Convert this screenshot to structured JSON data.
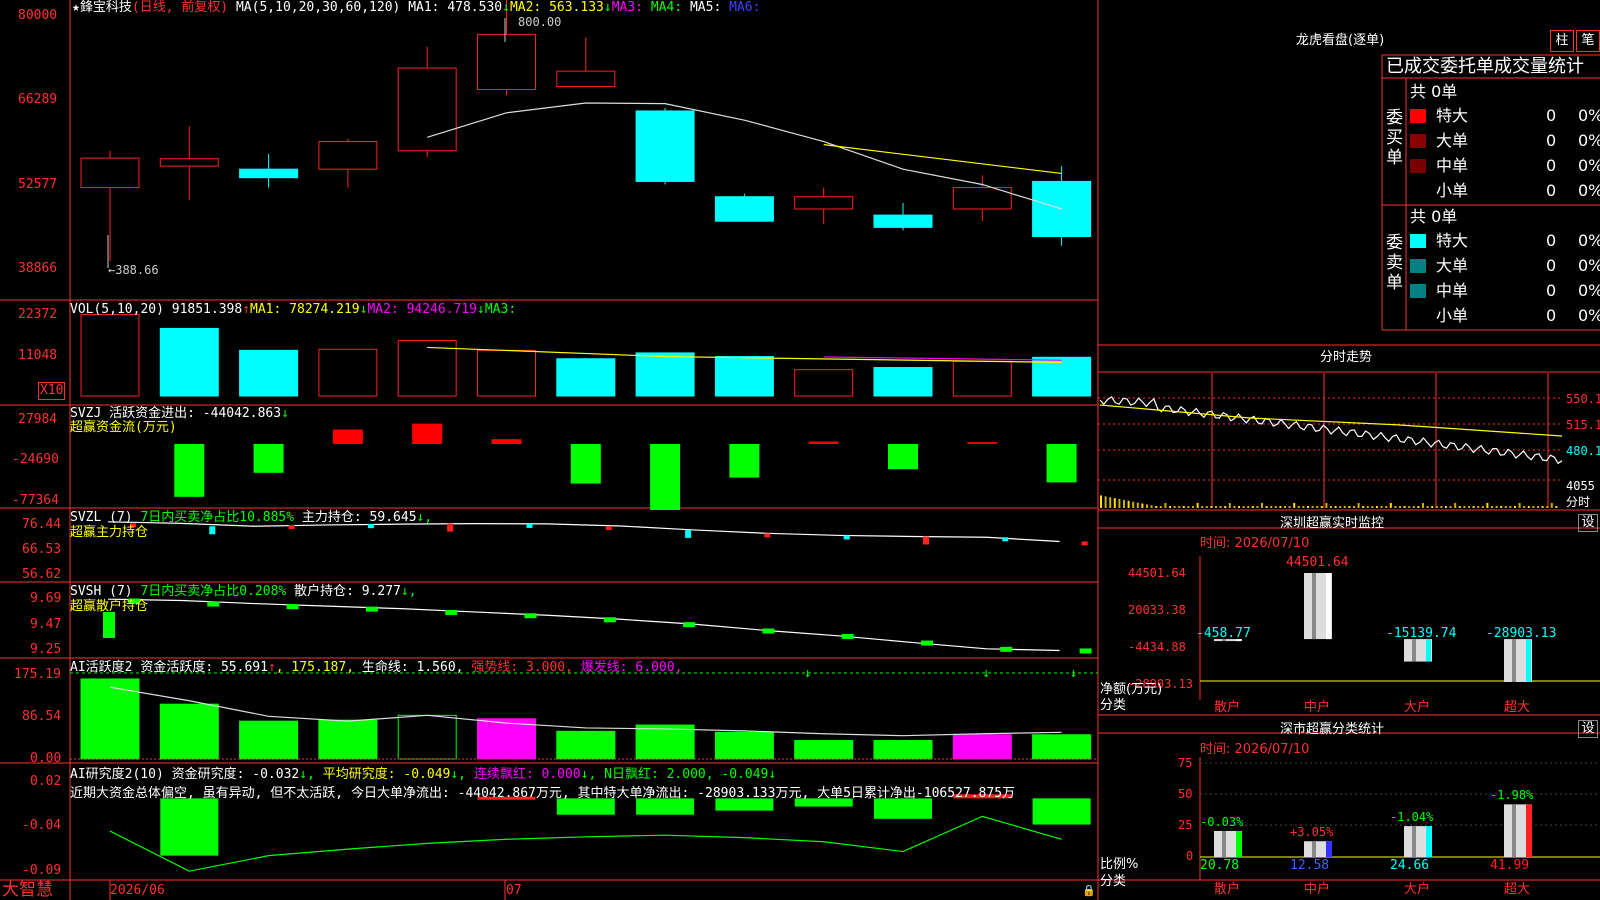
{
  "colors": {
    "up": "#ff2020",
    "down": "#00ffff",
    "green": "#00ff00",
    "magenta": "#ff00ff",
    "yellow": "#ffff00",
    "white": "#ffffff",
    "grid": "#c00000",
    "axis": "#ff3030",
    "darkred": "#8b0000",
    "teal": "#008080"
  },
  "price_panel": {
    "title_star": "★",
    "stock_name": "鋒宝科技",
    "mode": "(日线, 前复权)",
    "ma_params": "MA(5,10,20,30,60,120)",
    "ma1": "MA1: 478.530",
    "ma2": "MA2: 563.133",
    "ma3": "MA3:",
    "ma4": "MA4:",
    "ma5": "MA5:",
    "ma6": "MA6:",
    "y_ticks": [
      "80000",
      "66289",
      "52577",
      "38866"
    ],
    "high_label": "800.00",
    "low_label": "←388.66",
    "arrow_down": "↓"
  },
  "chart_data": {
    "type": "candlestick",
    "candles": [
      {
        "o": 52000,
        "h": 58000,
        "l": 40000,
        "c": 56800
      },
      {
        "o": 55500,
        "h": 62000,
        "l": 50000,
        "c": 56700
      },
      {
        "o": 55000,
        "h": 57500,
        "l": 52000,
        "c": 53600
      },
      {
        "o": 55000,
        "h": 60000,
        "l": 52000,
        "c": 59500
      },
      {
        "o": 58000,
        "h": 75000,
        "l": 57000,
        "c": 71500
      },
      {
        "o": 68000,
        "h": 89000,
        "l": 67000,
        "c": 77000
      },
      {
        "o": 68500,
        "h": 76500,
        "l": 68500,
        "c": 71000
      },
      {
        "o": 64500,
        "h": 65000,
        "l": 52500,
        "c": 53000
      },
      {
        "o": 50500,
        "h": 51000,
        "l": 46500,
        "c": 46500
      },
      {
        "o": 48500,
        "h": 52000,
        "l": 46000,
        "c": 50500
      },
      {
        "o": 47500,
        "h": 49500,
        "l": 45000,
        "c": 45500
      },
      {
        "o": 48500,
        "h": 54000,
        "l": 46500,
        "c": 52000
      },
      {
        "o": 53000,
        "h": 55500,
        "l": 42500,
        "c": 44000
      }
    ],
    "ma1": [
      null,
      null,
      null,
      null,
      60200,
      64200,
      65800,
      65700,
      63000,
      59500,
      55000,
      52500,
      48500
    ],
    "ma2": [
      null,
      null,
      null,
      null,
      null,
      null,
      null,
      null,
      null,
      59000,
      null,
      null,
      54300
    ],
    "volumes": [
      {
        "v": 22300,
        "up": true
      },
      {
        "v": 18500,
        "up": false
      },
      {
        "v": 12500,
        "up": false
      },
      {
        "v": 12800,
        "up": true
      },
      {
        "v": 15200,
        "up": true
      },
      {
        "v": 12500,
        "up": true
      },
      {
        "v": 10200,
        "up": false
      },
      {
        "v": 11800,
        "up": false
      },
      {
        "v": 10800,
        "up": false
      },
      {
        "v": 7200,
        "up": true
      },
      {
        "v": 7800,
        "up": false
      },
      {
        "v": 9500,
        "up": true
      },
      {
        "v": 10600,
        "up": false
      }
    ],
    "svzj": [
      {
        "v": null
      },
      {
        "v": -44000,
        "c": "g"
      },
      {
        "v": -24000,
        "c": "g"
      },
      {
        "v": 12000,
        "c": "r"
      },
      {
        "v": 17000,
        "c": "r"
      },
      {
        "v": 4000,
        "c": "r"
      },
      {
        "v": -33000,
        "c": "g"
      },
      {
        "v": -55000,
        "c": "g"
      },
      {
        "v": -28000,
        "c": "g"
      },
      {
        "v": 2000,
        "c": "r"
      },
      {
        "v": -21000,
        "c": "g"
      },
      {
        "v": 1500,
        "c": "r"
      },
      {
        "v": -32000,
        "c": "g"
      }
    ],
    "svzl_line": [
      76.9,
      76.3,
      75.2,
      75.7,
      76.0,
      76.2,
      76.1,
      75.3,
      73.8,
      72.5,
      71.7,
      71.3,
      71.0,
      69.4
    ],
    "svsh_line": [
      9.68,
      9.669,
      9.643,
      9.621,
      9.6,
      9.572,
      9.544,
      9.51,
      9.469,
      9.415,
      9.369,
      9.313,
      9.26,
      9.246
    ],
    "ai_active": [
      {
        "v": 165,
        "c": "g"
      },
      {
        "v": 113,
        "c": "g"
      },
      {
        "v": 78,
        "c": "g"
      },
      {
        "v": 80,
        "c": "g"
      },
      {
        "v": 90,
        "c": "hollow"
      },
      {
        "v": 83,
        "c": "m"
      },
      {
        "v": 57,
        "c": "g"
      },
      {
        "v": 70,
        "c": "g"
      },
      {
        "v": 55,
        "c": "g"
      },
      {
        "v": 38,
        "c": "g"
      },
      {
        "v": 38,
        "c": "g"
      },
      {
        "v": 50,
        "c": "m"
      },
      {
        "v": 50,
        "c": "g"
      }
    ],
    "ai_active_line": [
      148,
      120,
      88,
      78,
      90,
      74,
      64,
      62,
      58,
      52,
      48,
      52,
      55
    ],
    "ai_research": [
      {
        "v": 0,
        "c": "g"
      },
      {
        "v": -0.07,
        "c": "g"
      },
      {
        "v": 0,
        "c": "g"
      },
      {
        "v": 0,
        "c": "g"
      },
      {
        "v": 0,
        "c": "g"
      },
      {
        "v": 0.002,
        "c": "r"
      },
      {
        "v": -0.02,
        "c": "g"
      },
      {
        "v": -0.02,
        "c": "g"
      },
      {
        "v": -0.015,
        "c": "g"
      },
      {
        "v": -0.01,
        "c": "g"
      },
      {
        "v": -0.025,
        "c": "g"
      },
      {
        "v": 0.005,
        "c": "r"
      },
      {
        "v": -0.032,
        "c": "g"
      }
    ],
    "ai_research_line": [
      -0.04,
      -0.089,
      -0.07,
      -0.062,
      -0.055,
      -0.05,
      -0.047,
      -0.045,
      -0.048,
      -0.053,
      -0.065,
      -0.022,
      -0.05
    ]
  },
  "vol_panel": {
    "label": "VOL(5,10,20)",
    "v": "91851.398",
    "ma1": "MA1: 78274.219",
    "ma2": "MA2: 94246.719",
    "ma3": "MA3:",
    "y_ticks": [
      "22372",
      "11048"
    ],
    "x10": "X10"
  },
  "svzj_panel": {
    "label": "SVZJ",
    "desc": "活跃资金进出: -44042.863",
    "sub": "超赢资金流(万元)",
    "y_ticks": [
      "27984",
      "-24690",
      "-77364"
    ]
  },
  "svzl_panel": {
    "label": "SVZL (7)",
    "pct": "7日内买卖净占比10.885%",
    "hold": "主力持仓: 59.645",
    "sub": "超赢主力持仓",
    "y_ticks": [
      "76.44",
      "66.53",
      "56.62"
    ]
  },
  "svsh_panel": {
    "label": "SVSH (7)",
    "pct": "7日内买卖净占比0.208%",
    "hold": "散户持仓: 9.277",
    "sub": "超赢散户持仓",
    "y_ticks": [
      "9.69",
      "9.47",
      "9.25"
    ]
  },
  "ai_active_panel": {
    "label": "AI活跃度2",
    "a": "资金活跃度: 55.691",
    "b": ", 175.187,",
    "c": "生命线: 1.560,",
    "d": "强势线: 3.000,",
    "e": "爆发线: 6.000,",
    "y_ticks": [
      "175.19",
      "86.54",
      "0.00"
    ]
  },
  "ai_research_panel": {
    "label": "AI研究度2(10)",
    "a": "资金研究度: -0.032",
    "b": "平均研究度: -0.049",
    "c": "连续飘红: 0.000",
    "d": "N日飘红: 2.000, -0.049",
    "comment": "近期大资金总体偏空, 虽有异动, 但不太活跃, 今日大单净流出: -44042.867万元, 其中特大单净流出: -28903.133万元, 大单5日累计净出-106527.875万",
    "y_ticks": [
      "0.02",
      "-0.04",
      "-0.09"
    ]
  },
  "bottom": {
    "logo": "大智慧",
    "date1": "2026/06",
    "date2": "07"
  },
  "right": {
    "lhkp_title": "龙虎看盘(逐单)",
    "btn_zhu": "柱",
    "btn_bi": "笔",
    "tabs": "已成交委托单成交量统计",
    "buy": {
      "side": "委买单",
      "total": "共 0单",
      "rows": [
        {
          "name": "特大",
          "v": "0",
          "p": "0%",
          "color": "#ff0000"
        },
        {
          "name": "大单",
          "v": "0",
          "p": "0%",
          "color": "#8b0000"
        },
        {
          "name": "中单",
          "v": "0",
          "p": "0%",
          "color": "#7a0000"
        },
        {
          "name": "小单",
          "v": "0",
          "p": "0%",
          "color": ""
        }
      ]
    },
    "sell": {
      "side": "委卖单",
      "total": "共 0单",
      "rows": [
        {
          "name": "特大",
          "v": "0",
          "p": "0%",
          "color": "#00ffff"
        },
        {
          "name": "大单",
          "v": "0",
          "p": "0%",
          "color": "#008080"
        },
        {
          "name": "中单",
          "v": "0",
          "p": "0%",
          "color": "#008080"
        },
        {
          "name": "小单",
          "v": "0",
          "p": "0%",
          "color": ""
        }
      ]
    },
    "fenshi_title": "分时走势",
    "fenshi_ticks": [
      "550.1",
      "515.1",
      "480.1",
      "4055",
      "分时"
    ],
    "sz_title": "深圳超赢实时监控",
    "sz_btn": "设",
    "sz_time": "时间: 2026/07/10",
    "sz_yticks": [
      "44501.64",
      "20033.38",
      "-4434.88",
      "-28903.13"
    ],
    "sz_ylabel1": "净额(万元)",
    "sz_ylabel2": "分类",
    "sz_values": [
      "-458.77",
      "44501.64",
      "-15139.74",
      "-28903.13"
    ],
    "sz_nums": [
      -458.77,
      44501.64,
      -15139.74,
      -28903.13
    ],
    "sz_cats": [
      "散户",
      "中户",
      "大户",
      "超大"
    ],
    "sc_title": "深市超赢分类统计",
    "sc_btn": "设",
    "sc_time": "时间: 2026/07/10",
    "sc_yticks": [
      "75",
      "50",
      "25",
      "0"
    ],
    "sc_ylabel1": "比例%",
    "sc_ylabel2": "分类",
    "sc_pcts": [
      "-0.03%",
      "+3.05%",
      "-1.04%",
      "-1.98%"
    ],
    "sc_vals": [
      "20.78",
      "12.58",
      "24.66",
      "41.99"
    ],
    "sc_nums": [
      20.78,
      12.58,
      24.66,
      41.99
    ],
    "sc_cats": [
      "散户",
      "中户",
      "大户",
      "超大"
    ]
  }
}
